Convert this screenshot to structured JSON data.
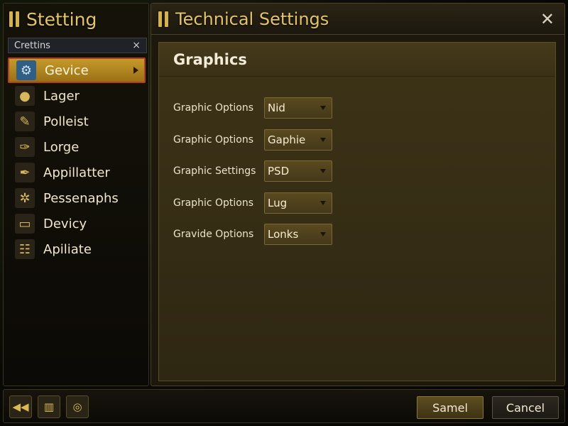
{
  "left_panel": {
    "title": "Stetting",
    "search": {
      "value": "Crettins",
      "clear_glyph": "×"
    },
    "items": [
      {
        "label": "Gevice",
        "icon": "gears-icon",
        "glyph": "⚙",
        "active": true
      },
      {
        "label": "Lager",
        "icon": "lightbulb-icon",
        "glyph": "●",
        "active": false
      },
      {
        "label": "Polleist",
        "icon": "pencil-icon",
        "glyph": "✎",
        "active": false
      },
      {
        "label": "Lorge",
        "icon": "brush-icon",
        "glyph": "✑",
        "active": false
      },
      {
        "label": "Appillatter",
        "icon": "quill-icon",
        "glyph": "✒",
        "active": false
      },
      {
        "label": "Pessenaphs",
        "icon": "cog-pair-icon",
        "glyph": "✲",
        "active": false
      },
      {
        "label": "Devicy",
        "icon": "display-icon",
        "glyph": "▭",
        "active": false
      },
      {
        "label": "Apiliate",
        "icon": "network-icon",
        "glyph": "☷",
        "active": false
      }
    ]
  },
  "right_panel": {
    "title": "Technical  Settings",
    "close_glyph": "✕",
    "section_title": "Graphics",
    "options": [
      {
        "label": "Graphic Options",
        "value": "Nid"
      },
      {
        "label": "Graphic Options",
        "value": "Gaphie"
      },
      {
        "label": "Graphic Settings",
        "value": "PSD"
      },
      {
        "label": "Graphic Options",
        "value": "Lug"
      },
      {
        "label": "Gravide Options",
        "value": "Lonks"
      }
    ]
  },
  "bottom_bar": {
    "icons": [
      {
        "name": "rewind-icon",
        "glyph": "◀◀"
      },
      {
        "name": "inventory-icon",
        "glyph": "▥"
      },
      {
        "name": "target-icon",
        "glyph": "◎"
      }
    ],
    "save_label": "Samel",
    "cancel_label": "Cancel"
  },
  "colors": {
    "accent_gold": "#e3c46a",
    "active_item": "#c59a2a",
    "active_border": "#b0401c"
  }
}
